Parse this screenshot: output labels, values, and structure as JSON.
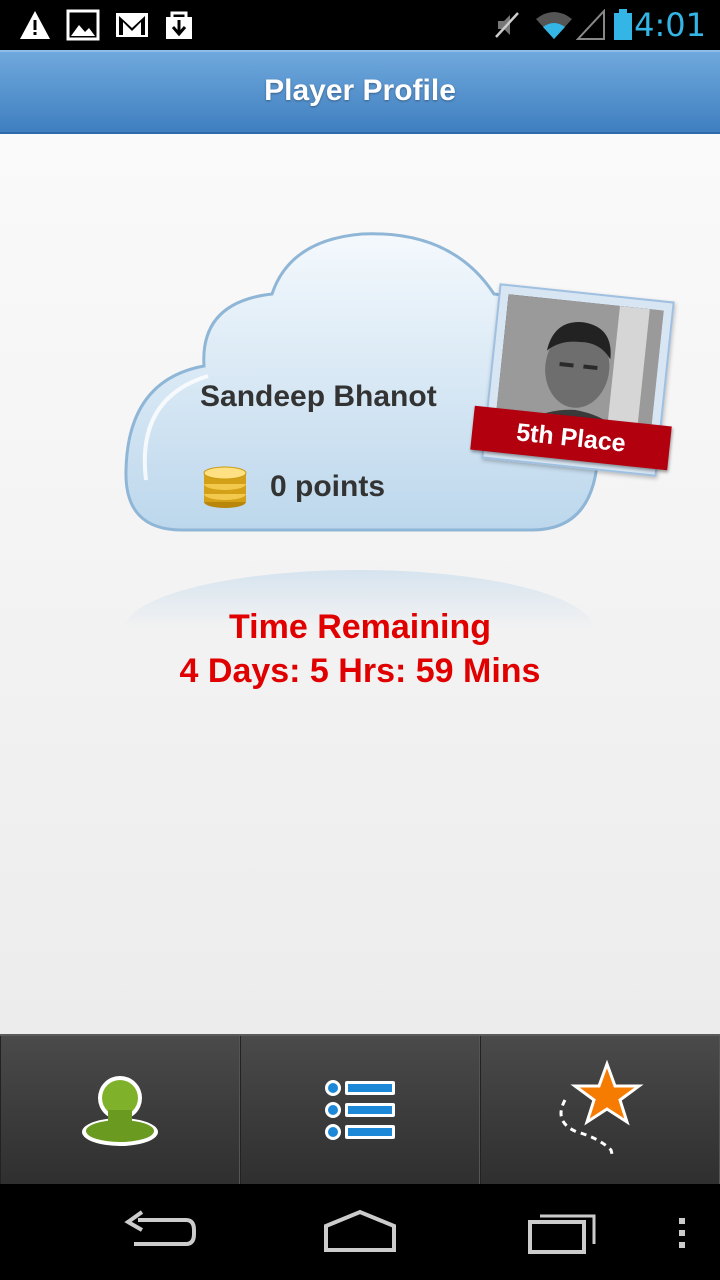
{
  "status_bar": {
    "time": "4:01",
    "icons": [
      "warning-icon",
      "image-icon",
      "gmail-icon",
      "download-icon",
      "mute-icon",
      "wifi-icon",
      "signal-icon",
      "battery-icon"
    ]
  },
  "header": {
    "title": "Player Profile"
  },
  "profile": {
    "name": "Sandeep Bhanot",
    "points": "0 points",
    "rank": "5th Place"
  },
  "countdown": {
    "label": "Time Remaining",
    "value": "4 Days: 5 Hrs: 59 Mins"
  },
  "tabs": [
    {
      "icon": "profile-icon",
      "active": true
    },
    {
      "icon": "list-icon"
    },
    {
      "icon": "star-path-icon"
    }
  ],
  "nav": [
    "back-icon",
    "home-icon",
    "recents-icon",
    "menu-icon"
  ],
  "colors": {
    "accent_red": "#e00000",
    "header_blue": "#4f8ccc",
    "ribbon_red": "#b3000f",
    "status_blue": "#33b5e5"
  }
}
